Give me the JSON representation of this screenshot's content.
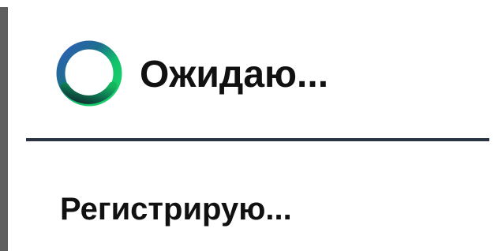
{
  "dialog": {
    "title": "Ожидаю...",
    "message": "Регистрирую...",
    "spinner_icon": "loading-spinner-icon",
    "colors": {
      "spinner_primary": "#1FD46B",
      "spinner_secondary": "#0E7A53",
      "spinner_shadow": "#0F2C2F",
      "spinner_accent": "#2F5DB8",
      "divider": "#2A3342",
      "text": "#111111",
      "background": "#FFFFFF"
    }
  }
}
